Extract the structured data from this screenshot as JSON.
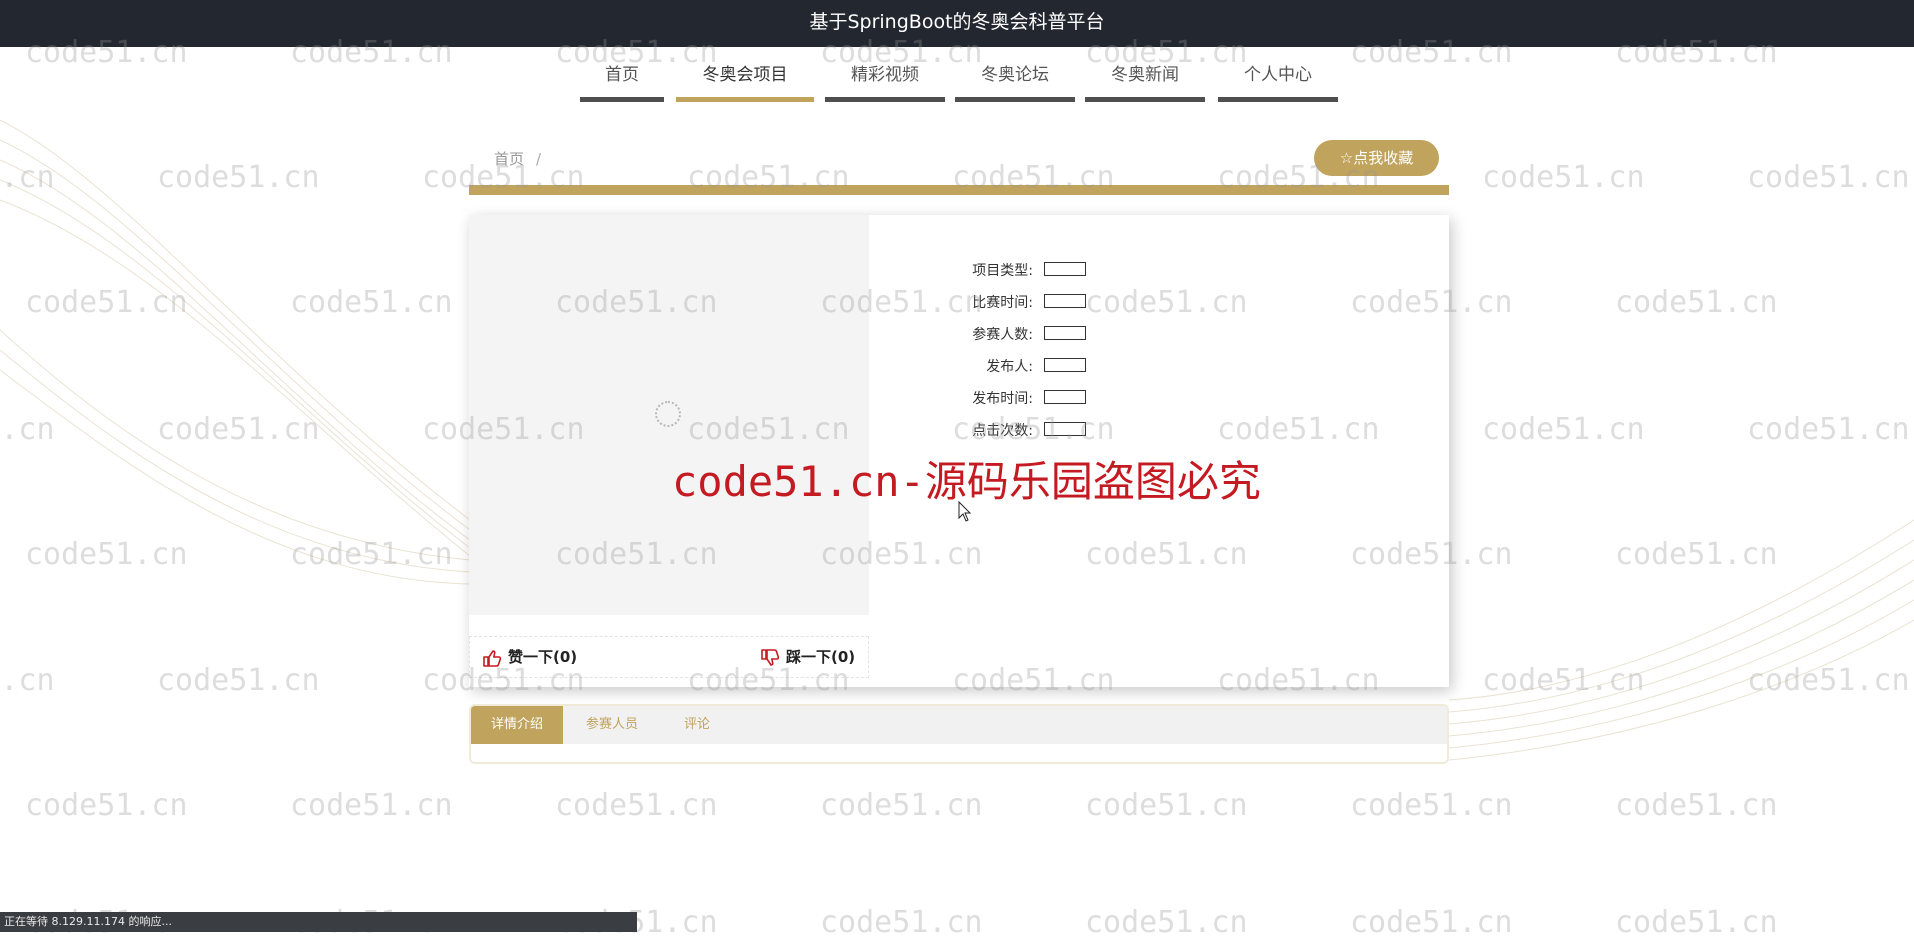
{
  "header": {
    "title": "基于SpringBoot的冬奥会科普平台"
  },
  "nav": {
    "items": [
      {
        "label": "首页",
        "active": false
      },
      {
        "label": "冬奥会项目",
        "active": true
      },
      {
        "label": "精彩视频",
        "active": false
      },
      {
        "label": "冬奥论坛",
        "active": false
      },
      {
        "label": "冬奥新闻",
        "active": false
      },
      {
        "label": "个人中心",
        "active": false
      }
    ]
  },
  "breadcrumb": {
    "home": "首页",
    "separator": "/"
  },
  "collect_button": {
    "icon": "star-outline-icon",
    "label": "☆点我收藏"
  },
  "detail": {
    "fields": [
      {
        "label": "项目类型:",
        "value": ""
      },
      {
        "label": "比赛时间:",
        "value": ""
      },
      {
        "label": "参赛人数:",
        "value": ""
      },
      {
        "label": "发布人:",
        "value": ""
      },
      {
        "label": "发布时间:",
        "value": ""
      },
      {
        "label": "点击次数:",
        "value": ""
      }
    ]
  },
  "votes": {
    "like_label": "赞一下(0)",
    "dislike_label": "踩一下(0)"
  },
  "tabs": [
    {
      "label": "详情介绍",
      "active": true
    },
    {
      "label": "参赛人员",
      "active": false
    },
    {
      "label": "评论",
      "active": false
    }
  ],
  "watermark": {
    "tile": "code51.cn",
    "main": "code51.cn-源码乐园盗图必究",
    "main_color": "#c41a21"
  },
  "status_bar": {
    "text": "正在等待 8.129.11.174 的响应..."
  },
  "colors": {
    "accent": "#c0a35c",
    "topbar": "#23272f",
    "nav_bar": "#4f4f4f"
  }
}
